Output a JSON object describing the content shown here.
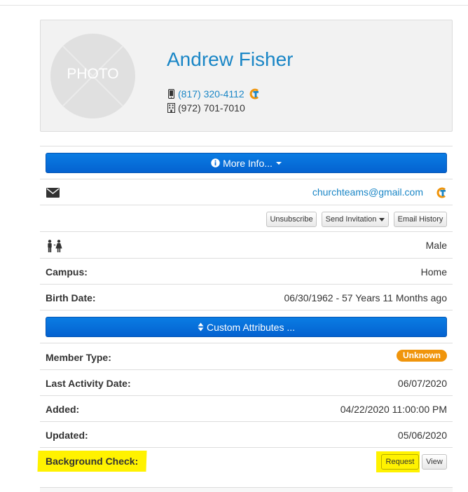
{
  "profile": {
    "photo_label": "PHOTO",
    "name": "Andrew Fisher",
    "mobile_phone": "(817) 320-4112",
    "office_phone": "(972) 701-7010"
  },
  "buttons": {
    "more_info": "More Info...",
    "custom_attributes": "Custom Attributes ...",
    "unsubscribe": "Unsubscribe",
    "send_invitation": "Send Invitation",
    "email_history": "Email History",
    "request": "Request",
    "view": "View"
  },
  "email": "churchteams@gmail.com",
  "fields": {
    "gender": "Male",
    "campus_label": "Campus:",
    "campus_value": "Home",
    "birth_label": "Birth Date:",
    "birth_value": "06/30/1962 - 57 Years 11 Months ago",
    "member_type_label": "Member Type:",
    "member_type_value": "Unknown",
    "last_activity_label": "Last Activity Date:",
    "last_activity_value": "06/07/2020",
    "added_label": "Added:",
    "added_value": "04/22/2020 11:00:00 PM",
    "updated_label": "Updated:",
    "updated_value": "05/06/2020",
    "background_check_label": "Background Check:"
  },
  "icons": {
    "mobile": "mobile-phone-icon",
    "office": "building-icon",
    "churchteams": "churchteams-logo-icon",
    "info": "info-circle-icon",
    "email": "envelope-icon",
    "gender": "male-female-icon",
    "sort": "sort-arrows-icon"
  },
  "colors": {
    "link": "#1a86c6",
    "primary_button": "#0a6fe0",
    "badge": "#f0950c",
    "highlight": "#fff200"
  }
}
